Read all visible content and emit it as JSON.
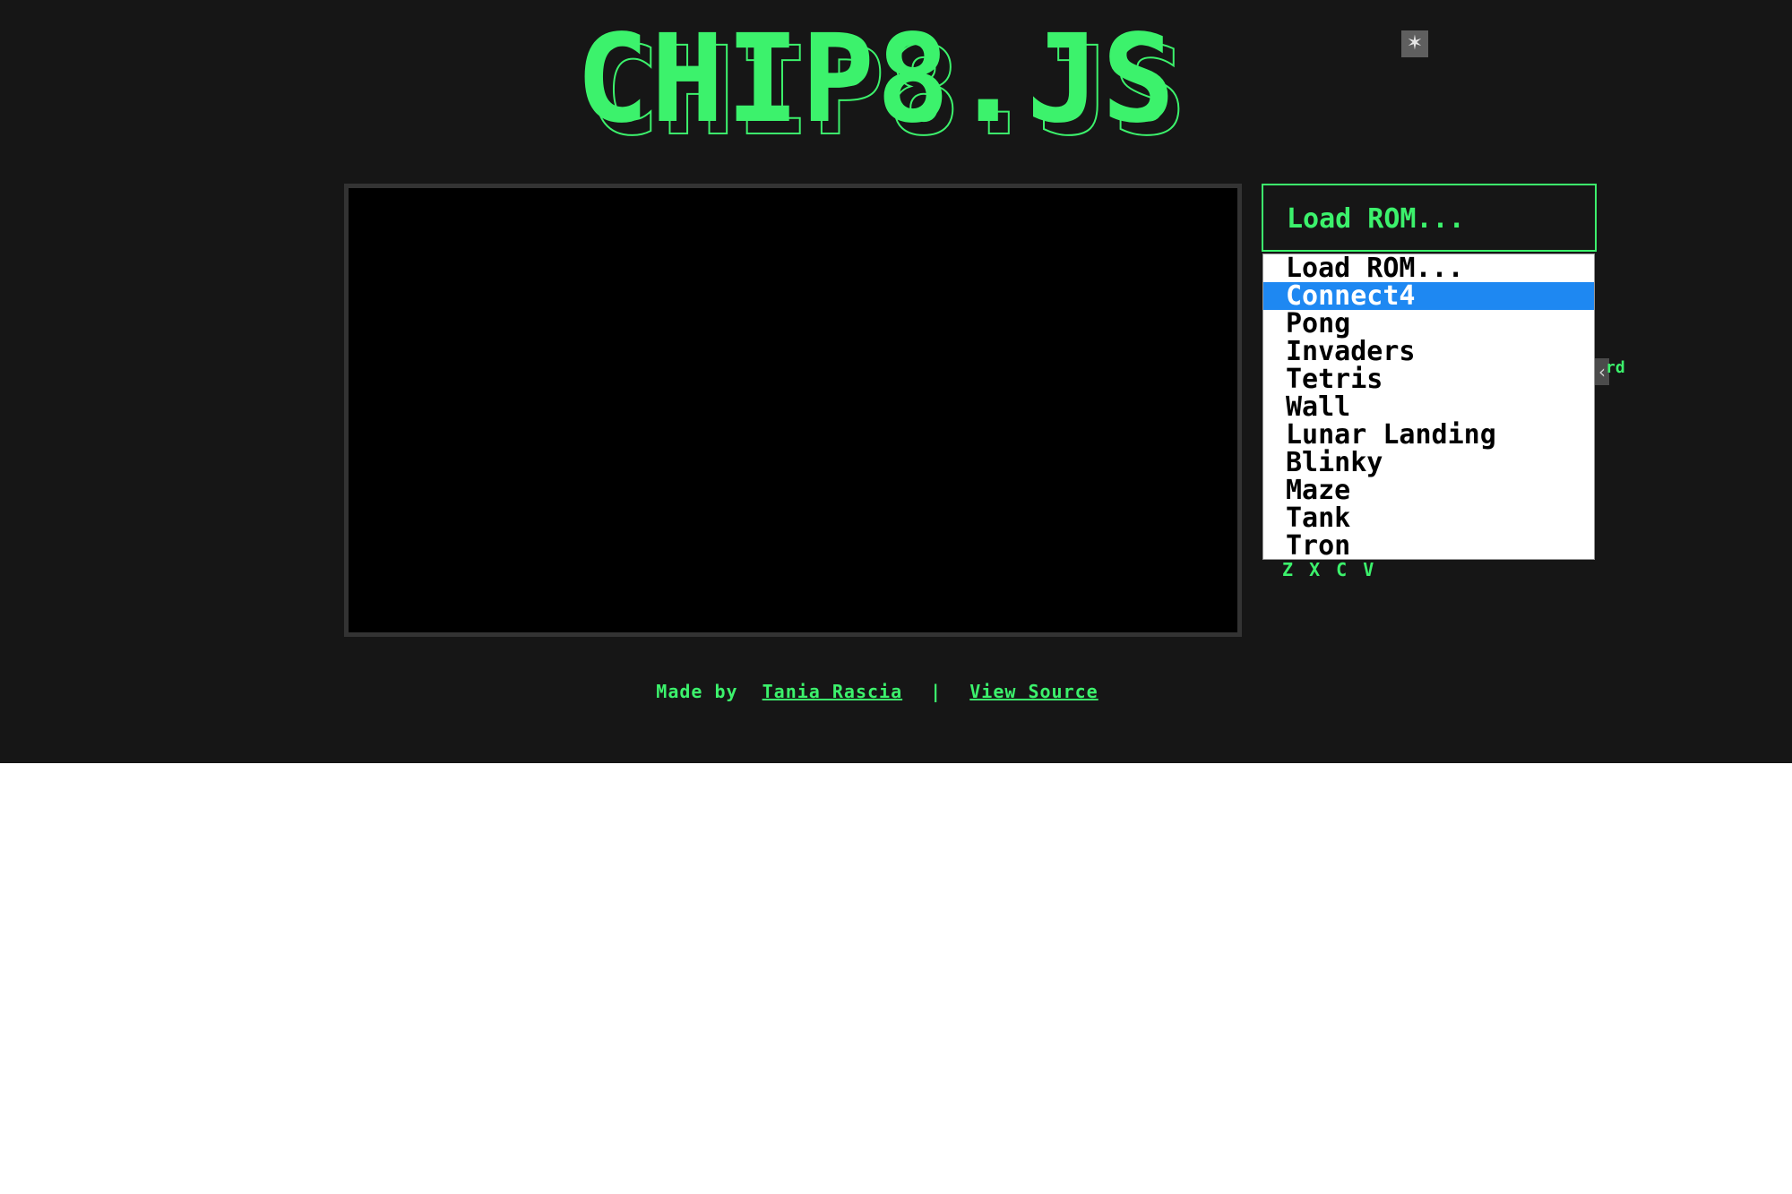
{
  "header": {
    "logo_text": "CHIP8.JS"
  },
  "controls": {
    "rom_select": {
      "selected_label": "Load ROM...",
      "options": [
        "Load ROM...",
        "Connect4",
        "Pong",
        "Invaders",
        "Tetris",
        "Wall",
        "Lunar Landing",
        "Blinky",
        "Maze",
        "Tank",
        "Tron"
      ],
      "highlighted_option": "Connect4"
    },
    "partial_label": "rd",
    "keys_row": "Z X C V"
  },
  "footer": {
    "made_by_label": "Made by",
    "author_link": "Tania Rascia",
    "separator": "|",
    "source_link": "View Source"
  },
  "colors": {
    "accent": "#3cf26c",
    "background": "#161616",
    "screen": "#000000",
    "highlight": "#1e88f2"
  }
}
